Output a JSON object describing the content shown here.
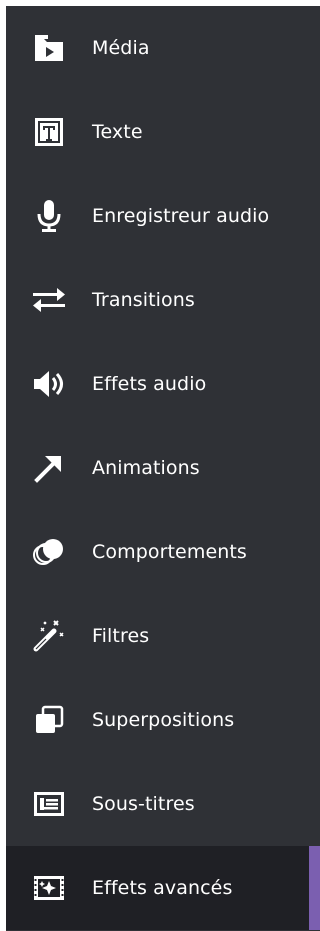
{
  "sidebar": {
    "accent_color": "#7b5fb0",
    "active_index": 10,
    "items": [
      {
        "label": "Média",
        "icon": "media-folder-icon"
      },
      {
        "label": "Texte",
        "icon": "text-box-icon"
      },
      {
        "label": "Enregistreur audio",
        "icon": "microphone-icon"
      },
      {
        "label": "Transitions",
        "icon": "swap-arrows-icon"
      },
      {
        "label": "Effets audio",
        "icon": "speaker-icon"
      },
      {
        "label": "Animations",
        "icon": "diagonal-arrow-icon"
      },
      {
        "label": "Comportements",
        "icon": "overlapping-circles-icon"
      },
      {
        "label": "Filtres",
        "icon": "magic-wand-icon"
      },
      {
        "label": "Superpositions",
        "icon": "overlay-squares-icon"
      },
      {
        "label": "Sous-titres",
        "icon": "subtitles-icon"
      },
      {
        "label": "Effets avancés",
        "icon": "film-sparkle-icon"
      }
    ]
  }
}
